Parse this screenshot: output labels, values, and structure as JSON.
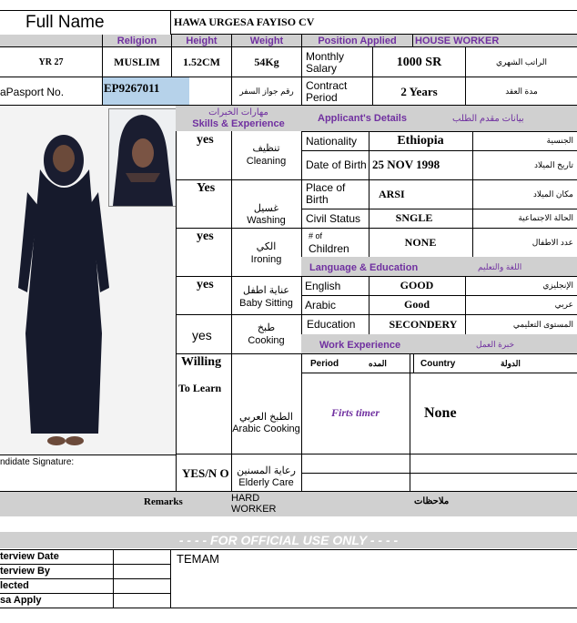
{
  "header": {
    "full_name_label": "Full Name",
    "name_value": "HAWA URGESA FAYISO CV",
    "religion_label": "Religion",
    "height_label": "Height",
    "weight_label": "Weight",
    "position_label": "Position Applied",
    "position_value": "HOUSE WORKER",
    "age_value": "YR 27",
    "religion_value": "MUSLIM",
    "height_value": "1.52CM",
    "weight_value": "54Kg",
    "monthly_salary_label": "Monthly Salary",
    "salary_value": "1000 SR",
    "salary_ar": "الراتب الشهري",
    "passport_label": "aPasport No.",
    "passport_value": "EP9267011",
    "passport_ar": "رقم جواز السفر",
    "contract_label": "Contract Period",
    "contract_value": "2 Years",
    "contract_ar": "مدة العقد"
  },
  "skills": {
    "title_ar": "مهارات الخبرات",
    "title_en": "Skills & Experience",
    "items": [
      {
        "answer": "yes",
        "ar": "تنظيف",
        "en": "Cleaning"
      },
      {
        "answer": "Yes",
        "ar": "غسيل",
        "en": "Washing"
      },
      {
        "answer": "yes",
        "ar": "الكي",
        "en": "Ironing"
      },
      {
        "answer": "yes",
        "ar": "عناية اطفل",
        "en": "Baby Sitting"
      },
      {
        "answer": "yes",
        "ar": "طبخ",
        "en": "Cooking"
      }
    ],
    "willing_1": "Willing",
    "willing_2": "To Learn",
    "arabic_cooking_ar": "الطبخ العربي",
    "arabic_cooking_en": "Arabic Cooking",
    "elderly_answer": "YES/N O",
    "elderly_ar": "رعاية المسنين",
    "elderly_en": "Elderly Care"
  },
  "details": {
    "title_en": "Applicant's Details",
    "title_ar": "بيانات مقدم الطلب",
    "rows": [
      {
        "label": "Nationality",
        "value": "Ethiopia",
        "ar": "الجنسية"
      },
      {
        "label": "Date of Birth",
        "value": "25 NOV 1998",
        "ar": "تاريخ الميلاد"
      },
      {
        "label": "Place of Birth",
        "value": "ARSI",
        "ar": "مكان الميلاد"
      },
      {
        "label": "Civil Status",
        "value": "SNGLE",
        "ar": "الحالة الاجتماعية"
      },
      {
        "label_1": "# of",
        "label_2": "Children",
        "value": "NONE",
        "ar": "عدد الاطفال"
      }
    ]
  },
  "language": {
    "title_en": "Language & Education",
    "title_ar": "اللغة والتعليم",
    "rows": [
      {
        "label": "English",
        "value": "GOOD",
        "ar": "الإنجليزي"
      },
      {
        "label": "Arabic",
        "value": "Good",
        "ar": "عربي"
      },
      {
        "label": "Education",
        "value": "SECONDERY",
        "ar": "المستوى التعليمي"
      }
    ]
  },
  "work": {
    "title_en": "Work Experience",
    "title_ar": "خبرة العمل",
    "period_label": "Period",
    "period_ar": "المده",
    "country_label": "Country",
    "country_ar": "الدولة",
    "period_value": "Firts timer",
    "country_value": "None"
  },
  "signature_label": "ndidate Signature:",
  "remarks": {
    "label": "Remarks",
    "value": "HARD WORKER",
    "ar": "ملاحظات"
  },
  "official": {
    "banner": "- - - - FOR OFFICIAL USE ONLY - - - -",
    "rows": [
      "terview Date",
      "terview By",
      "lected",
      "sa Apply"
    ],
    "agency": "TEMAM"
  },
  "colors": {
    "accent": "#7030a0",
    "band": "#d0d0d0",
    "passport_highlight": "#b6d2ea"
  }
}
